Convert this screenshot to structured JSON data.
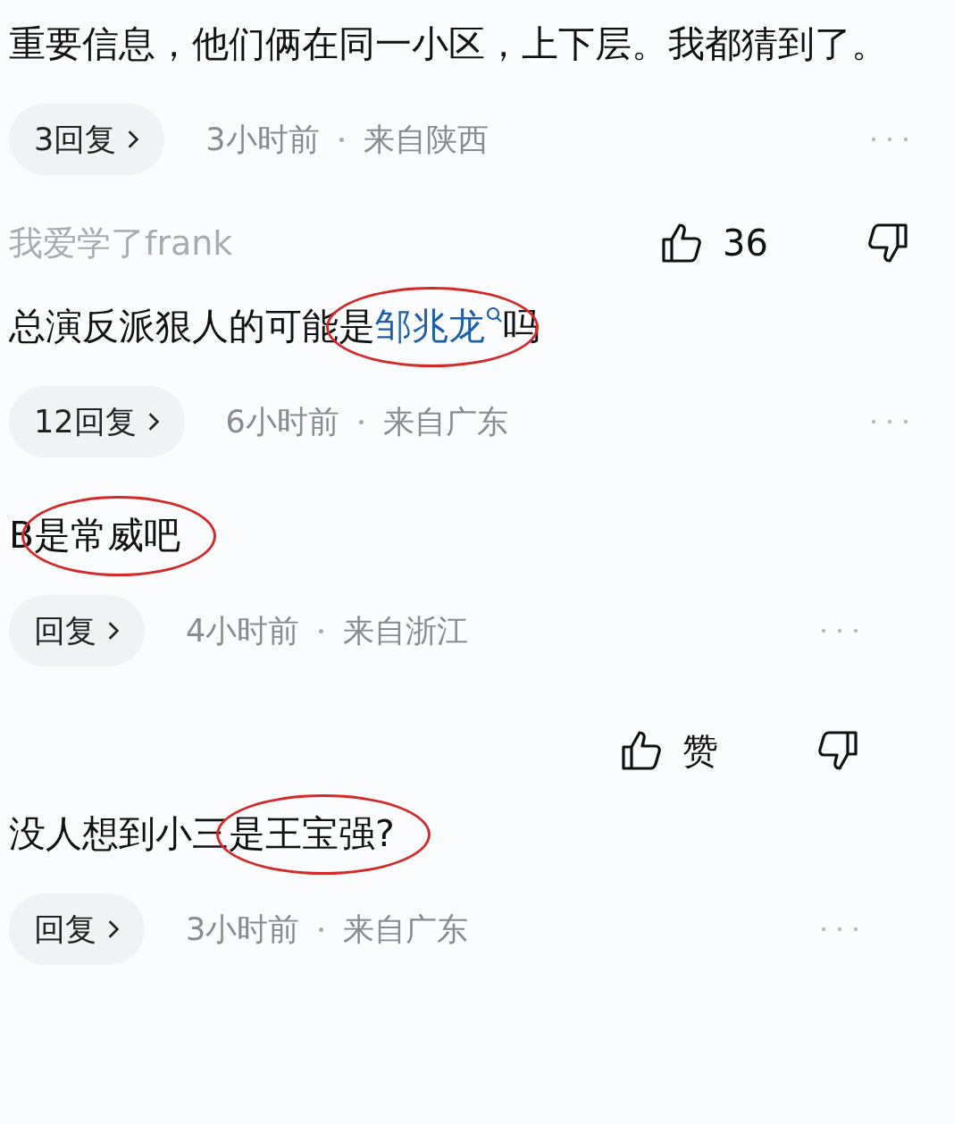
{
  "comments": [
    {
      "kind": "top",
      "body": {
        "before": "重要信息，他们俩在同一小区，上下层。我都猜到了。"
      },
      "reply": "3回复",
      "time": "3小时前",
      "location": "来自陕西"
    },
    {
      "kind": "top",
      "header": {
        "author": "我爱学了frank",
        "likes": "36"
      },
      "body": {
        "before": "总演反派狠人的可能",
        "circled": [
          {
            "kind": "plain",
            "text": "是"
          },
          {
            "kind": "link",
            "text": "邹兆龙"
          }
        ],
        "after": "吗"
      },
      "reply": "12回复",
      "time": "6小时前",
      "location": "来自广东"
    },
    {
      "kind": "sub",
      "body": {
        "before": "B",
        "circled": [
          {
            "kind": "plain",
            "text": "是常威吧"
          }
        ]
      },
      "reply": "回复",
      "time": "4小时前",
      "location": "来自浙江"
    },
    {
      "kind": "sub",
      "header": {
        "likes": "赞"
      },
      "body": {
        "before": "没人想到小三",
        "circled": [
          {
            "kind": "plain",
            "text": "是王宝强?"
          }
        ]
      },
      "reply": "回复",
      "time": "3小时前",
      "location": "来自广东"
    }
  ]
}
